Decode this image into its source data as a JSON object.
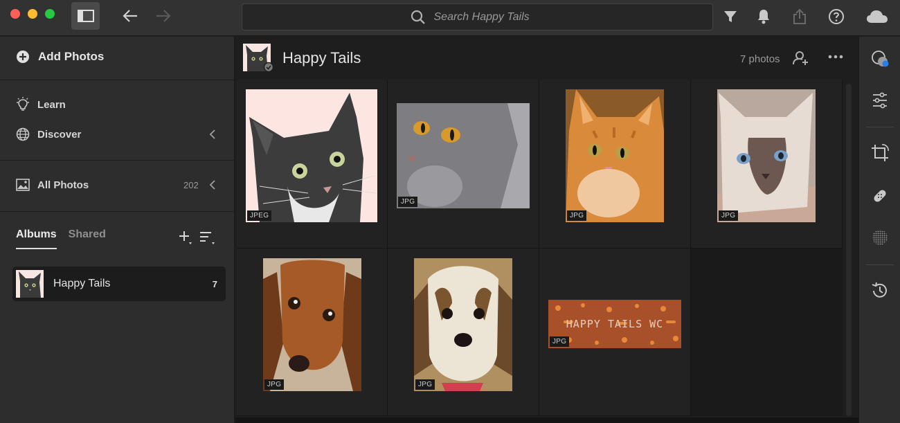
{
  "window": {
    "colors": {
      "close": "#fe5f57",
      "minimize": "#febc2e",
      "zoom": "#28c840",
      "accent": "#2680eb"
    }
  },
  "toolbar": {
    "search_placeholder": "Search Happy Tails",
    "icons": [
      "sidebar-toggle-icon",
      "back-arrow-icon",
      "forward-arrow-icon",
      "search-icon",
      "filter-icon",
      "bell-icon",
      "share-icon",
      "help-icon",
      "cloud-icon"
    ]
  },
  "sidebar": {
    "add_photos": "Add Photos",
    "learn": "Learn",
    "discover": "Discover",
    "all_photos": "All Photos",
    "all_photos_count": "202",
    "tabs": {
      "albums": "Albums",
      "shared": "Shared"
    },
    "albums": [
      {
        "name": "Happy Tails",
        "count": "7"
      }
    ]
  },
  "album": {
    "title": "Happy Tails",
    "count_label": "7 photos"
  },
  "photos": [
    {
      "type": "JPEG",
      "subject": "illustrated cat"
    },
    {
      "type": "JPG",
      "subject": "grey cat"
    },
    {
      "type": "JPG",
      "subject": "orange tabby cat"
    },
    {
      "type": "JPG",
      "subject": "siamese kitten"
    },
    {
      "type": "JPG",
      "subject": "dachshund"
    },
    {
      "type": "JPG",
      "subject": "shih tzu puppy"
    },
    {
      "type": "JPG",
      "subject": "paw print banner",
      "overlay_text": "HAPPY TAILS WC"
    }
  ],
  "right_panel": {
    "icons": [
      "mask-icon",
      "sliders-icon",
      "crop-icon",
      "healing-icon",
      "texture-icon",
      "history-icon"
    ]
  }
}
